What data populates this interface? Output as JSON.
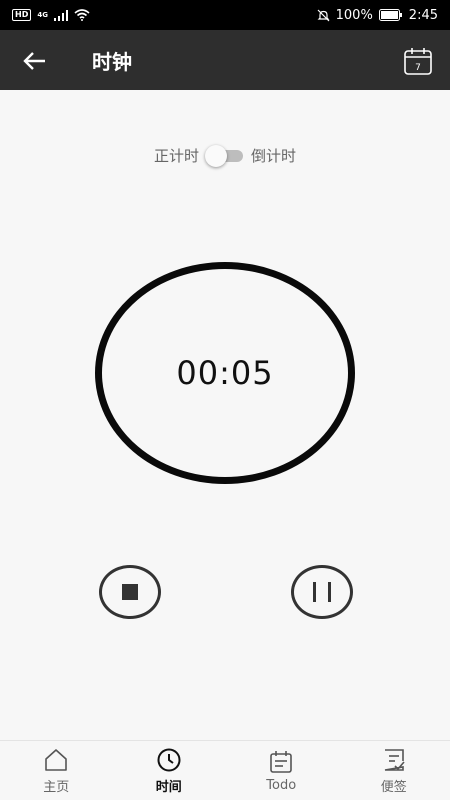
{
  "status_bar": {
    "hd": "HD",
    "network": "4G",
    "battery": "100%",
    "time": "2:45"
  },
  "app_bar": {
    "title": "时钟",
    "calendar_day": "7"
  },
  "mode_toggle": {
    "left_label": "正计时",
    "right_label": "倒计时",
    "on": false
  },
  "timer": {
    "display": "00:05"
  },
  "bottom_nav": {
    "items": [
      {
        "label": "主页",
        "icon": "home-icon",
        "active": false
      },
      {
        "label": "时间",
        "icon": "clock-icon",
        "active": true
      },
      {
        "label": "Todo",
        "icon": "calendar-icon",
        "active": false
      },
      {
        "label": "便签",
        "icon": "note-icon",
        "active": false
      }
    ]
  }
}
